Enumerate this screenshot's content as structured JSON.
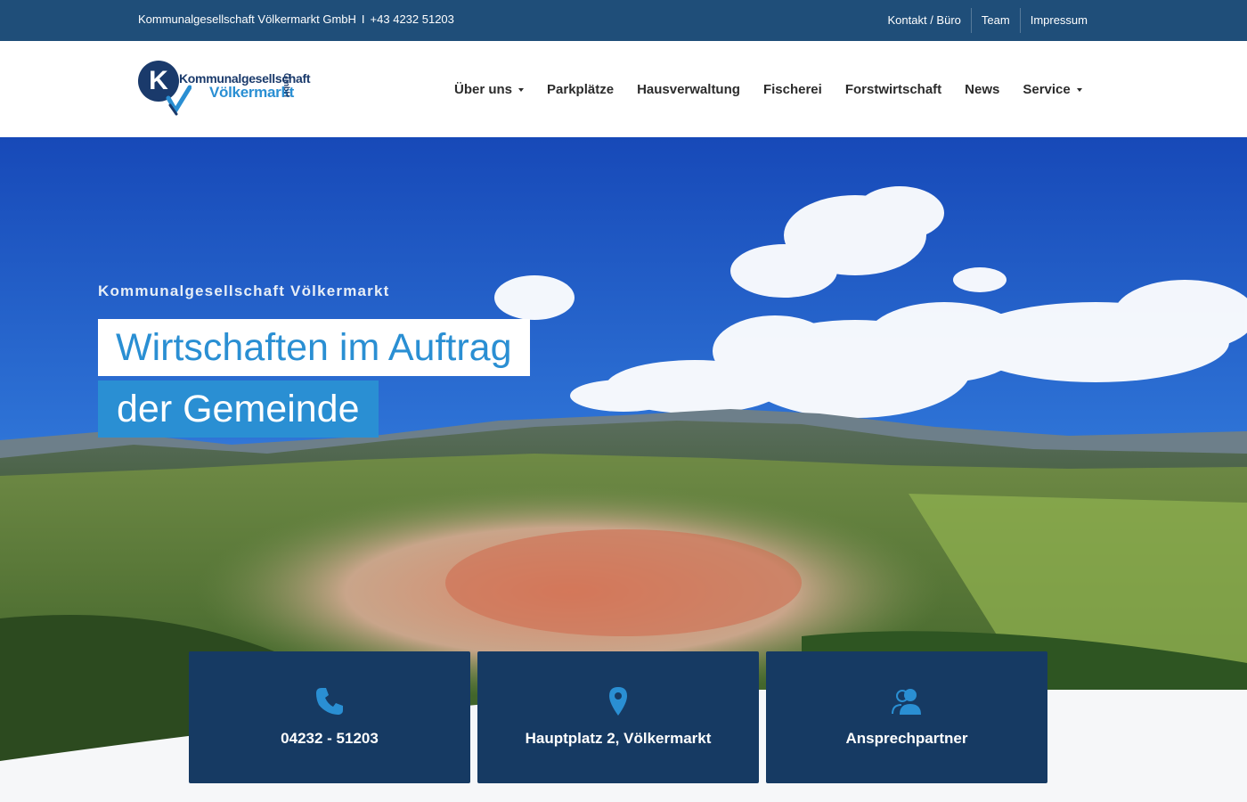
{
  "topbar": {
    "company": "Kommunalgesellschaft Völkermarkt GmbH",
    "separator": "I",
    "phone": "+43 4232 51203",
    "links": [
      "Kontakt / Büro",
      "Team",
      "Impressum"
    ]
  },
  "logo": {
    "letter": "K",
    "line1": "Kommunalgesellschaft",
    "line2": "Völkermarkt",
    "suffix": "GmbH"
  },
  "nav": {
    "items": [
      "Über uns",
      "Parkplätze",
      "Hausverwaltung",
      "Fischerei",
      "Forstwirtschaft",
      "News",
      "Service"
    ]
  },
  "hero": {
    "subtitle": "Kommunalgesellschaft Völkermarkt",
    "headline_line1": "Wirtschaften im Auftrag",
    "headline_line2": "der Gemeinde"
  },
  "cards": [
    {
      "icon": "phone-icon",
      "label": "04232 - 51203"
    },
    {
      "icon": "map-pin-icon",
      "label": "Hauptplatz 2, Völkermarkt"
    },
    {
      "icon": "contacts-icon",
      "label": "Ansprechpartner"
    }
  ],
  "colors": {
    "topbar": "#1f4e79",
    "accent": "#2a8fd3",
    "card": "#163a63",
    "navy": "#1a3a6b"
  }
}
